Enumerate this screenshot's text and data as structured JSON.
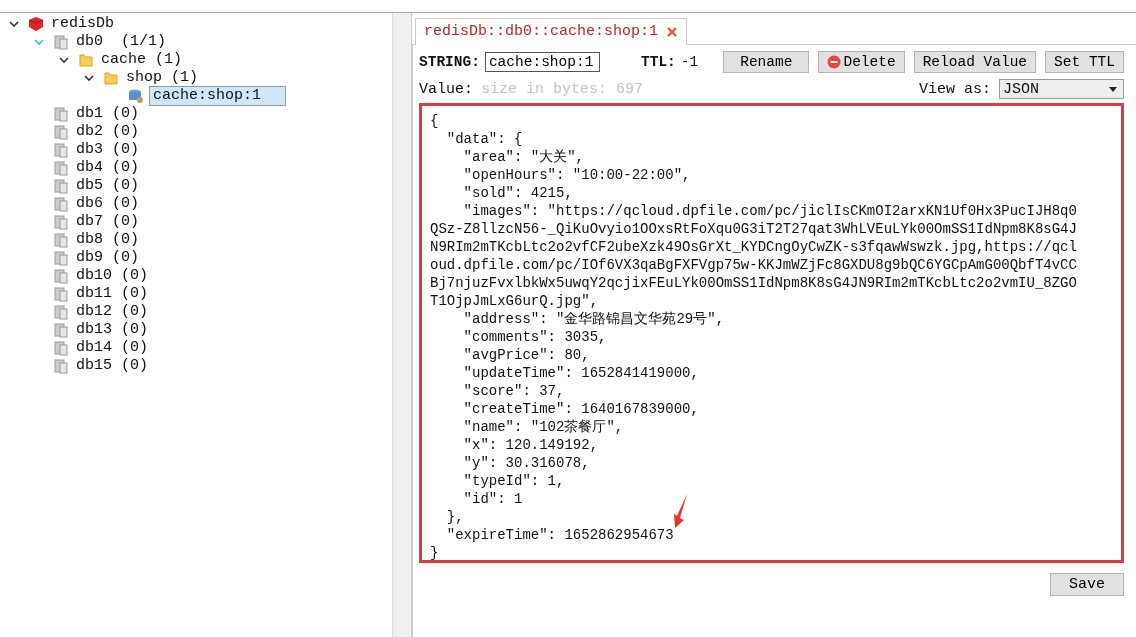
{
  "tree": [
    {
      "label": "redisDb",
      "kind": "server",
      "expanded": true,
      "selected": false,
      "children": [
        {
          "label": "db0  (1/1)",
          "kind": "db",
          "expanded": true,
          "selected": false,
          "children": [
            {
              "label": "cache (1)",
              "kind": "folder",
              "expanded": true,
              "selected": false,
              "children": [
                {
                  "label": "shop (1)",
                  "kind": "folder",
                  "expanded": true,
                  "selected": false,
                  "children": [
                    {
                      "label": "cache:shop:1",
                      "kind": "key",
                      "selected": true
                    }
                  ]
                }
              ]
            }
          ]
        },
        {
          "label": "db1 (0)",
          "kind": "db",
          "selected": false
        },
        {
          "label": "db2 (0)",
          "kind": "db",
          "selected": false
        },
        {
          "label": "db3 (0)",
          "kind": "db",
          "selected": false
        },
        {
          "label": "db4 (0)",
          "kind": "db",
          "selected": false
        },
        {
          "label": "db5 (0)",
          "kind": "db",
          "selected": false
        },
        {
          "label": "db6 (0)",
          "kind": "db",
          "selected": false
        },
        {
          "label": "db7 (0)",
          "kind": "db",
          "selected": false
        },
        {
          "label": "db8 (0)",
          "kind": "db",
          "selected": false
        },
        {
          "label": "db9 (0)",
          "kind": "db",
          "selected": false
        },
        {
          "label": "db10 (0)",
          "kind": "db",
          "selected": false
        },
        {
          "label": "db11 (0)",
          "kind": "db",
          "selected": false
        },
        {
          "label": "db12 (0)",
          "kind": "db",
          "selected": false
        },
        {
          "label": "db13 (0)",
          "kind": "db",
          "selected": false
        },
        {
          "label": "db14 (0)",
          "kind": "db",
          "selected": false
        },
        {
          "label": "db15 (0)",
          "kind": "db",
          "selected": false
        }
      ]
    }
  ],
  "tabs": [
    {
      "label": "redisDb::db0::cache:shop:1",
      "selected": true
    }
  ],
  "key_bar": {
    "type_label": "STRING:",
    "key": "cache:shop:1",
    "ttl_label": "TTL:",
    "ttl": "-1",
    "buttons": [
      {
        "label": "Rename",
        "kind": "plain"
      },
      {
        "label": "Delete",
        "kind": "delete"
      },
      {
        "label": "Reload Value",
        "kind": "plain"
      },
      {
        "label": "Set TTL",
        "kind": "plain"
      }
    ]
  },
  "value_bar": {
    "label": "Value:",
    "size": "size in bytes: 697",
    "view_label": "View as:",
    "view_as": "JSON"
  },
  "editor": {
    "highlighted": true,
    "lines": [
      "{",
      "  \"data\": {",
      "    \"area\": \"大关\",",
      "    \"openHours\": \"10:00-22:00\",",
      "    \"sold\": 4215,",
      "    \"images\": \"https://qcloud.dpfile.com/pc/jiclIsCKmOI2arxKN1Uf0Hx3PucIJH8q0",
      "QSz-Z8llzcN56-_QiKuOvyio1OOxsRtFoXqu0G3iT2T27qat3WhLVEuLYk00OmSS1IdNpm8K8sG4J",
      "N9RIm2mTKcbLtc2o2vfCF2ubeXzk49OsGrXt_KYDCngOyCwZK-s3fqawWswzk.jpg,https://qcl",
      "oud.dpfile.com/pc/IOf6VX3qaBgFXFVgp75w-KKJmWZjFc8GXDU8g9bQC6YGCpAmG00QbfT4vCC",
      "Bj7njuzFvxlbkWx5uwqY2qcjixFEuLYk00OmSS1IdNpm8K8sG4JN9RIm2mTKcbLtc2o2vmIU_8ZGO",
      "T1OjpJmLxG6urQ.jpg\",",
      "    \"address\": \"金华路锦昌文华苑29号\",",
      "    \"comments\": 3035,",
      "    \"avgPrice\": 80,",
      "    \"updateTime\": 1652841419000,",
      "    \"score\": 37,",
      "    \"createTime\": 1640167839000,",
      "    \"name\": \"102茶餐厅\",",
      "    \"x\": 120.149192,",
      "    \"y\": 30.316078,",
      "    \"typeId\": 1,",
      "    \"id\": 1",
      "  },",
      "  \"expireTime\": 1652862954673",
      "}"
    ]
  },
  "save_button": "Save"
}
